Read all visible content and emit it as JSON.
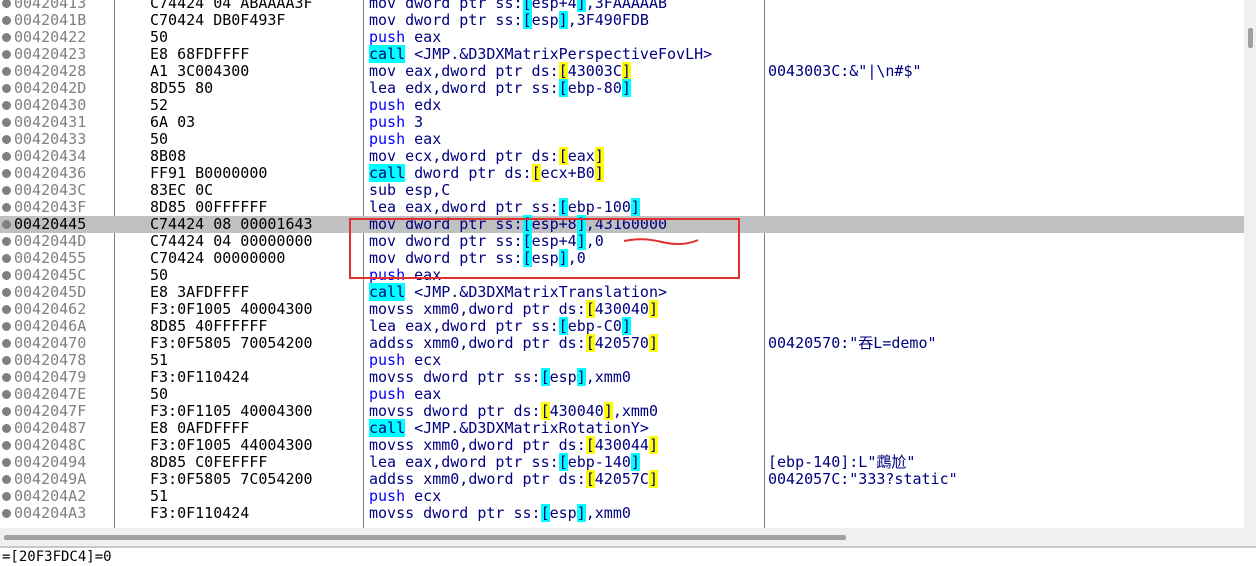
{
  "colors": {
    "selected_row": "#c0c0c0",
    "annotation": "#e03030",
    "call_highlight": "#00ffff",
    "label_highlight": "#ffff00"
  },
  "rows": [
    {
      "addr": "00420413",
      "bytes": "C74424 04 ABAAAA3F",
      "instr": "mov dword ptr ss:[esp+4],3FAAAAAB",
      "cmt": ""
    },
    {
      "addr": "0042041B",
      "bytes": "C70424 DB0F493F",
      "instr": "mov dword ptr ss:[esp],3F490FDB",
      "cmt": ""
    },
    {
      "addr": "00420422",
      "bytes": "50",
      "instr": "push eax",
      "cmt": ""
    },
    {
      "addr": "00420423",
      "bytes": "E8 68FDFFFF",
      "instr": "call <JMP.&D3DXMatrixPerspectiveFovLH>",
      "cmt": ""
    },
    {
      "addr": "00420428",
      "bytes": "A1 3C004300",
      "instr": "mov eax,dword ptr ds:[43003C]",
      "cmt": "0043003C:&\"|\\n#$\""
    },
    {
      "addr": "0042042D",
      "bytes": "8D55 80",
      "instr": "lea edx,dword ptr ss:[ebp-80]",
      "cmt": ""
    },
    {
      "addr": "00420430",
      "bytes": "52",
      "instr": "push edx",
      "cmt": ""
    },
    {
      "addr": "00420431",
      "bytes": "6A 03",
      "instr": "push 3",
      "cmt": ""
    },
    {
      "addr": "00420433",
      "bytes": "50",
      "instr": "push eax",
      "cmt": ""
    },
    {
      "addr": "00420434",
      "bytes": "8B08",
      "instr": "mov ecx,dword ptr ds:[eax]",
      "cmt": ""
    },
    {
      "addr": "00420436",
      "bytes": "FF91 B0000000",
      "instr": "call dword ptr ds:[ecx+B0]",
      "cmt": ""
    },
    {
      "addr": "0042043C",
      "bytes": "83EC 0C",
      "instr": "sub esp,C",
      "cmt": ""
    },
    {
      "addr": "0042043F",
      "bytes": "8D85 00FFFFFF",
      "instr": "lea eax,dword ptr ss:[ebp-100]",
      "cmt": ""
    },
    {
      "addr": "00420445",
      "bytes": "C74424 08 00001643",
      "instr": "mov dword ptr ss:[esp+8],43160000",
      "cmt": ""
    },
    {
      "addr": "0042044D",
      "bytes": "C74424 04 00000000",
      "instr": "mov dword ptr ss:[esp+4],0",
      "cmt": ""
    },
    {
      "addr": "00420455",
      "bytes": "C70424 00000000",
      "instr": "mov dword ptr ss:[esp],0",
      "cmt": ""
    },
    {
      "addr": "0042045C",
      "bytes": "50",
      "instr": "push eax",
      "cmt": ""
    },
    {
      "addr": "0042045D",
      "bytes": "E8 3AFDFFFF",
      "instr": "call <JMP.&D3DXMatrixTranslation>",
      "cmt": ""
    },
    {
      "addr": "00420462",
      "bytes": "F3:0F1005 40004300",
      "instr": "movss xmm0,dword ptr ds:[430040]",
      "cmt": ""
    },
    {
      "addr": "0042046A",
      "bytes": "8D85 40FFFFFF",
      "instr": "lea eax,dword ptr ss:[ebp-C0]",
      "cmt": ""
    },
    {
      "addr": "00420470",
      "bytes": "F3:0F5805 70054200",
      "instr": "addss xmm0,dword ptr ds:[420570]",
      "cmt": "00420570:\"吞L=demo\""
    },
    {
      "addr": "00420478",
      "bytes": "51",
      "instr": "push ecx",
      "cmt": ""
    },
    {
      "addr": "00420479",
      "bytes": "F3:0F110424",
      "instr": "movss dword ptr ss:[esp],xmm0",
      "cmt": ""
    },
    {
      "addr": "0042047E",
      "bytes": "50",
      "instr": "push eax",
      "cmt": ""
    },
    {
      "addr": "0042047F",
      "bytes": "F3:0F1105 40004300",
      "instr": "movss dword ptr ds:[430040],xmm0",
      "cmt": ""
    },
    {
      "addr": "00420487",
      "bytes": "E8 0AFDFFFF",
      "instr": "call <JMP.&D3DXMatrixRotationY>",
      "cmt": ""
    },
    {
      "addr": "0042048C",
      "bytes": "F3:0F1005 44004300",
      "instr": "movss xmm0,dword ptr ds:[430044]",
      "cmt": ""
    },
    {
      "addr": "00420494",
      "bytes": "8D85 C0FEFFFF",
      "instr": "lea eax,dword ptr ss:[ebp-140]",
      "cmt": "[ebp-140]:L\"鵡尬\""
    },
    {
      "addr": "0042049A",
      "bytes": "F3:0F5805 7C054200",
      "instr": "addss xmm0,dword ptr ds:[42057C]",
      "cmt": "0042057C:\"333?static\""
    },
    {
      "addr": "004204A2",
      "bytes": "51",
      "instr": "push ecx",
      "cmt": ""
    },
    {
      "addr": "004204A3",
      "bytes": "F3:0F110424",
      "instr": "movss dword ptr ss:[esp],xmm0",
      "cmt": ""
    }
  ],
  "selected_index": 13,
  "status": "=[20F3FDC4]=0"
}
